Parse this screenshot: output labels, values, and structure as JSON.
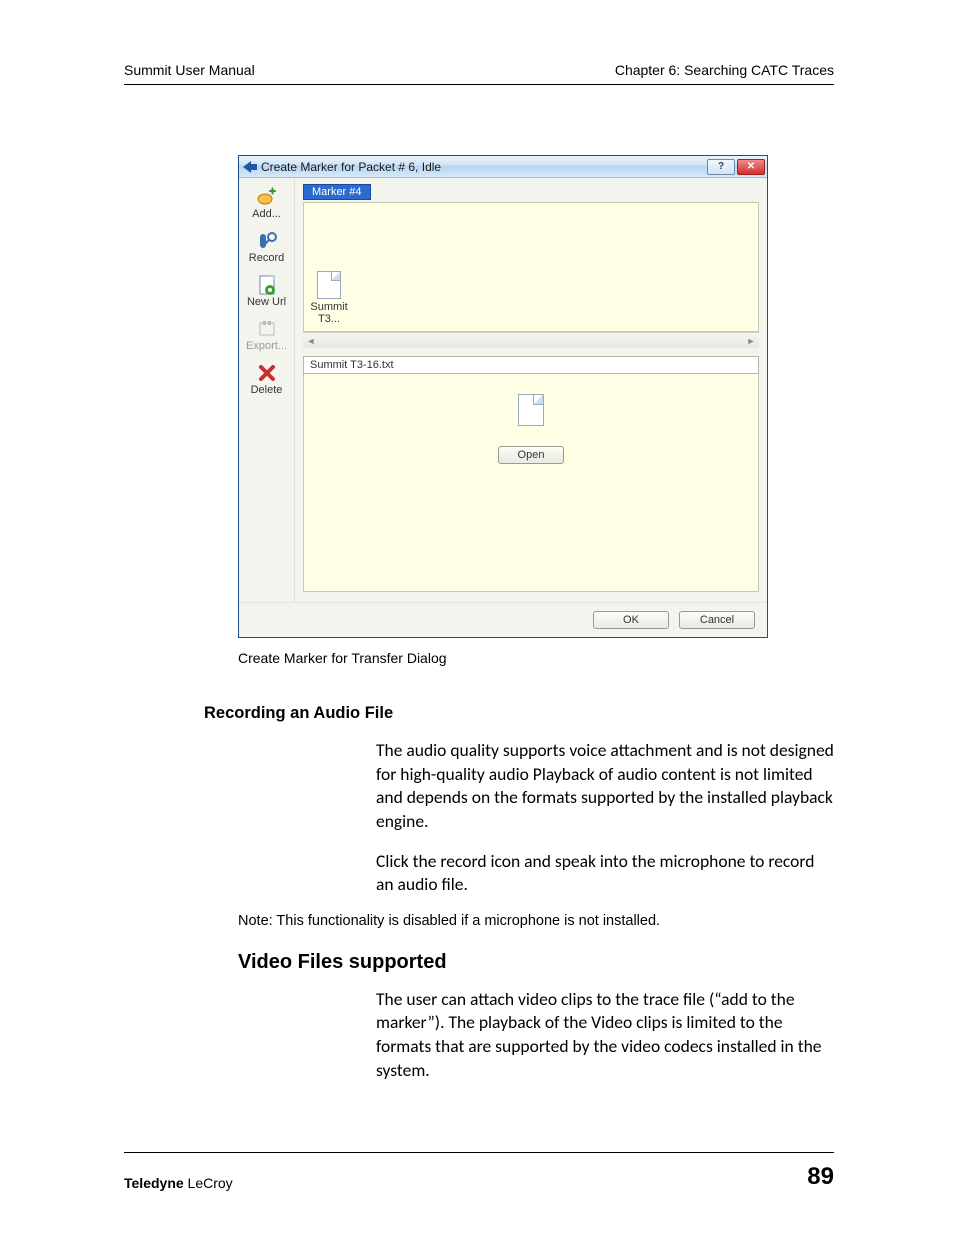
{
  "header": {
    "left": "Summit User Manual",
    "right": "Chapter 6: Searching CATC Traces"
  },
  "dialog": {
    "title": "Create Marker for Packet # 6, Idle",
    "sidebar": {
      "add": {
        "label": "Add..."
      },
      "record": {
        "label": "Record"
      },
      "newurl": {
        "label": "New Url"
      },
      "export": {
        "label": "Export..."
      },
      "delete": {
        "label": "Delete"
      }
    },
    "marker_label": "Marker #4",
    "file_label": "Summit T3...",
    "path_text": "Summit T3-16.txt",
    "open_label": "Open",
    "ok_label": "OK",
    "cancel_label": "Cancel"
  },
  "caption": "Create Marker for Transfer Dialog",
  "section_audio": {
    "heading": "Recording an Audio File",
    "p1": "The audio quality supports voice attachment and is not designed for high-quality audio Playback of audio content is not limited and depends on the formats supported by the installed playback engine.",
    "p2": "Click the record icon and speak into the microphone to record an audio file."
  },
  "note_text": "Note: This functionality is disabled if a microphone is not installed.",
  "section_video": {
    "heading": "Video Files supported",
    "p1": "The user can attach video clips to the trace file (“add to the marker”). The playback of the Video clips is limited to the formats that are supported by the video codecs installed in the system."
  },
  "footer": {
    "brand_bold": "Teledyne",
    "brand_rest": " LeCroy",
    "page_number": "89"
  }
}
